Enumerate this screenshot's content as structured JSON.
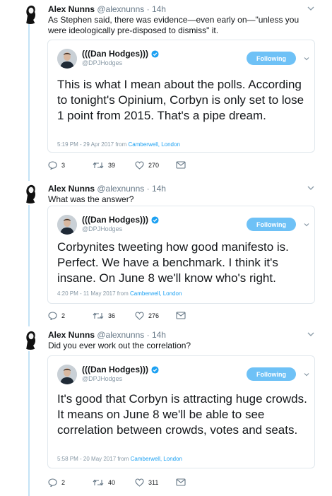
{
  "tweets": [
    {
      "author": {
        "name": "Alex Nunns",
        "handle": "@alexnunns",
        "time": "14h"
      },
      "text": "As Stephen said, there was evidence—even early on—\"unless you were ideologically pre-disposed to dismiss\" it.",
      "quote": {
        "name": "(((Dan Hodges)))",
        "handle": "@DPJHodges",
        "follow_label": "Following",
        "text": "This is what I mean about the polls. According to tonight's Opinium, Corbyn is only set to lose 1 point from 2015. That's a pipe dream.",
        "timestamp": "5:19 PM - 29 Apr 2017 from",
        "place": "Camberwell, London"
      },
      "replies": "3",
      "retweets": "39",
      "likes": "270"
    },
    {
      "author": {
        "name": "Alex Nunns",
        "handle": "@alexnunns",
        "time": "14h"
      },
      "text": "What was the answer?",
      "quote": {
        "name": "(((Dan Hodges)))",
        "handle": "@DPJHodges",
        "follow_label": "Following",
        "text": "Corbynites tweeting how good manifesto is. Perfect. We have a benchmark.  I think it's insane. On June 8 we'll know who's right.",
        "timestamp": "4:20 PM - 11 May 2017 from",
        "place": "Camberwell, London"
      },
      "replies": "2",
      "retweets": "36",
      "likes": "276"
    },
    {
      "author": {
        "name": "Alex Nunns",
        "handle": "@alexnunns",
        "time": "14h"
      },
      "text": "Did you ever work out the correlation?",
      "quote": {
        "name": "(((Dan Hodges)))",
        "handle": "@DPJHodges",
        "follow_label": "Following",
        "text": "It's good that Corbyn is attracting huge crowds. It means on June 8 we'll be able to see correlation between crowds, votes and seats.",
        "timestamp": "5:58 PM - 20 May 2017 from",
        "place": "Camberwell, London"
      },
      "replies": "2",
      "retweets": "40",
      "likes": "311"
    }
  ],
  "colors": {
    "thread_line": "#c4e3f5",
    "follow_button": "#6ec1f6",
    "link": "#1da1f2",
    "verified": "#1da1f2",
    "muted": "#657786"
  },
  "icons": [
    "avatar-silhouette",
    "chevron-down-icon",
    "verified-icon",
    "reply-icon",
    "retweet-icon",
    "like-icon",
    "dm-icon"
  ]
}
